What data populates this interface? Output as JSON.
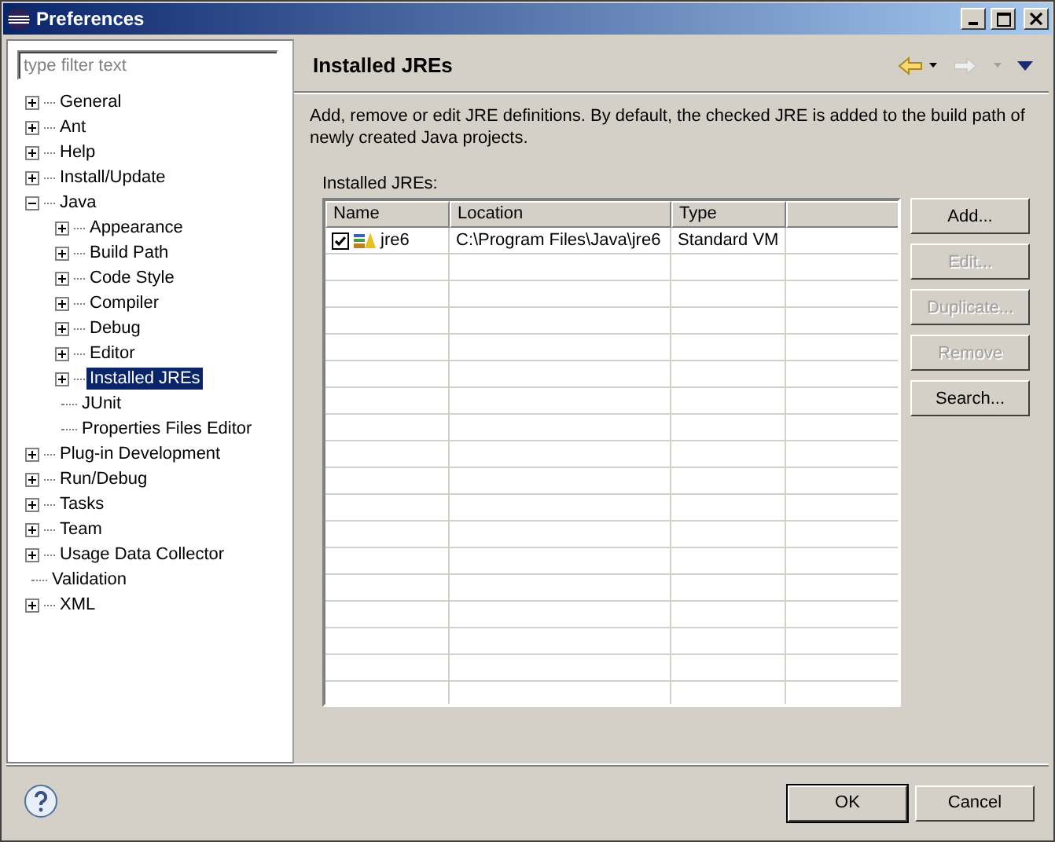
{
  "window": {
    "title": "Preferences"
  },
  "filter": {
    "placeholder": "type filter text"
  },
  "tree": [
    {
      "label": "General",
      "expanded": false,
      "selected": false
    },
    {
      "label": "Ant",
      "expanded": false,
      "selected": false
    },
    {
      "label": "Help",
      "expanded": false,
      "selected": false
    },
    {
      "label": "Install/Update",
      "expanded": false,
      "selected": false
    },
    {
      "label": "Java",
      "expanded": true,
      "selected": false,
      "children": [
        {
          "label": "Appearance",
          "expanded": false,
          "selected": false
        },
        {
          "label": "Build Path",
          "expanded": false,
          "selected": false
        },
        {
          "label": "Code Style",
          "expanded": false,
          "selected": false
        },
        {
          "label": "Compiler",
          "expanded": false,
          "selected": false
        },
        {
          "label": "Debug",
          "expanded": false,
          "selected": false
        },
        {
          "label": "Editor",
          "expanded": false,
          "selected": false
        },
        {
          "label": "Installed JREs",
          "expanded": false,
          "selected": true
        },
        {
          "label": "JUnit",
          "selected": false
        },
        {
          "label": "Properties Files Editor",
          "selected": false
        }
      ]
    },
    {
      "label": "Plug-in Development",
      "expanded": false,
      "selected": false
    },
    {
      "label": "Run/Debug",
      "expanded": false,
      "selected": false
    },
    {
      "label": "Tasks",
      "expanded": false,
      "selected": false
    },
    {
      "label": "Team",
      "expanded": false,
      "selected": false
    },
    {
      "label": "Usage Data Collector",
      "expanded": false,
      "selected": false
    },
    {
      "label": "Validation",
      "selected": false
    },
    {
      "label": "XML",
      "expanded": false,
      "selected": false
    }
  ],
  "page": {
    "title": "Installed JREs",
    "description": "Add, remove or edit JRE definitions. By default, the checked JRE is added to the build path of newly created Java projects.",
    "table_label": "Installed JREs:"
  },
  "table": {
    "columns": [
      "Name",
      "Location",
      "Type"
    ],
    "rows": [
      {
        "checked": true,
        "name": "jre6",
        "location": "C:\\Program Files\\Java\\jre6",
        "type": "Standard VM"
      }
    ]
  },
  "side_buttons": [
    {
      "label": "Add...",
      "disabled": false
    },
    {
      "label": "Edit...",
      "disabled": true
    },
    {
      "label": "Duplicate...",
      "disabled": true
    },
    {
      "label": "Remove",
      "disabled": true
    },
    {
      "label": "Search...",
      "disabled": false
    }
  ],
  "buttons": [
    {
      "label": "OK",
      "default": true
    },
    {
      "label": "Cancel",
      "default": false
    }
  ]
}
